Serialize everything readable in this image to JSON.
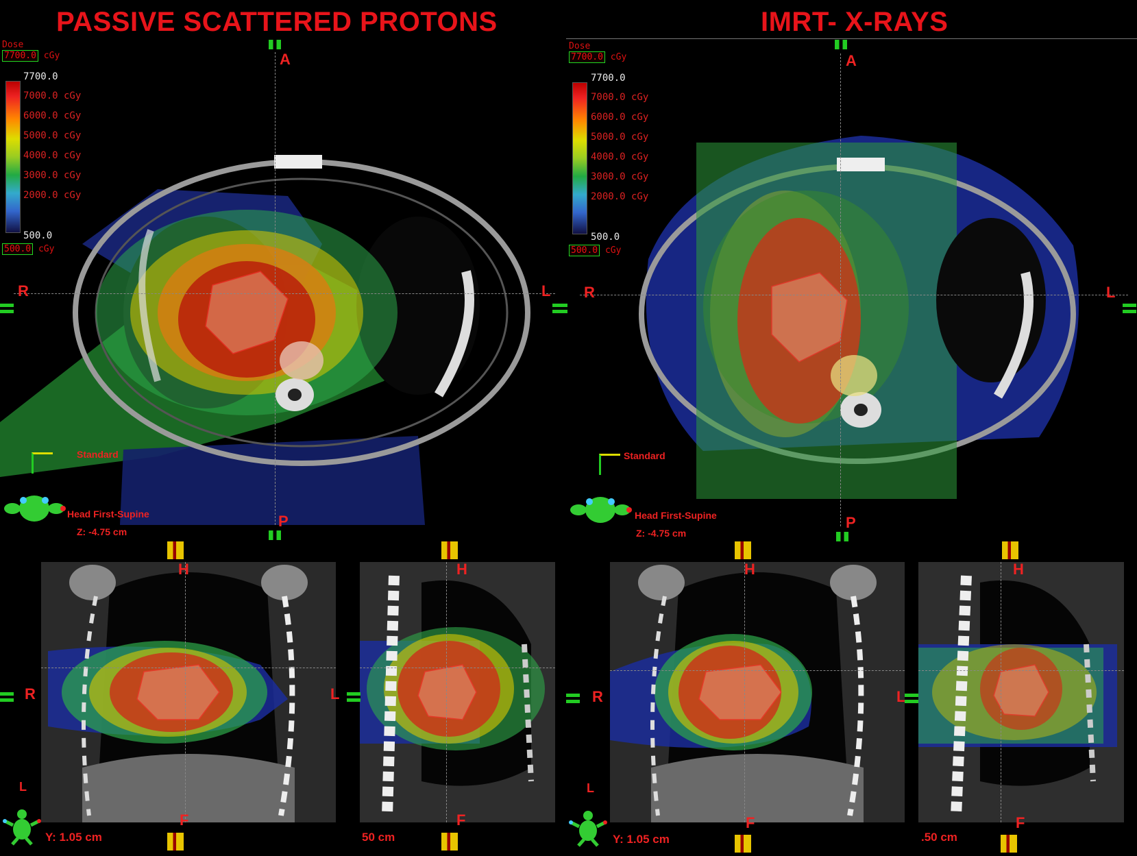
{
  "titles": {
    "left": "PASSIVE SCATTERED PROTONS",
    "right": "IMRT- X-RAYS"
  },
  "dose_legend": {
    "label": "Dose",
    "max_value": "7700.0",
    "unit": "cGy",
    "top_value": "7700.0",
    "ticks": [
      "7000.0 cGy",
      "6000.0 cGy",
      "5000.0 cGy",
      "4000.0 cGy",
      "3000.0 cGy",
      "2000.0 cGy"
    ],
    "bottom_value": "500.0",
    "min_value": "500.0"
  },
  "orientation": {
    "anterior": "A",
    "posterior": "P",
    "right": "R",
    "left": "L",
    "head": "H",
    "foot": "F"
  },
  "axial_info": {
    "view_name": "Standard",
    "patient_position": "Head First-Supine",
    "z_coord": "Z: -4.75 cm"
  },
  "coronal_info": {
    "y_coord": "Y: 1.05 cm"
  },
  "sagittal_info": {
    "left_coord": "50 cm",
    "right_coord": ".50 cm"
  },
  "colors": {
    "title": "#e8141a",
    "label": "#e22222",
    "marker_green": "#22cc22",
    "marker_yellow": "#e8c400"
  }
}
